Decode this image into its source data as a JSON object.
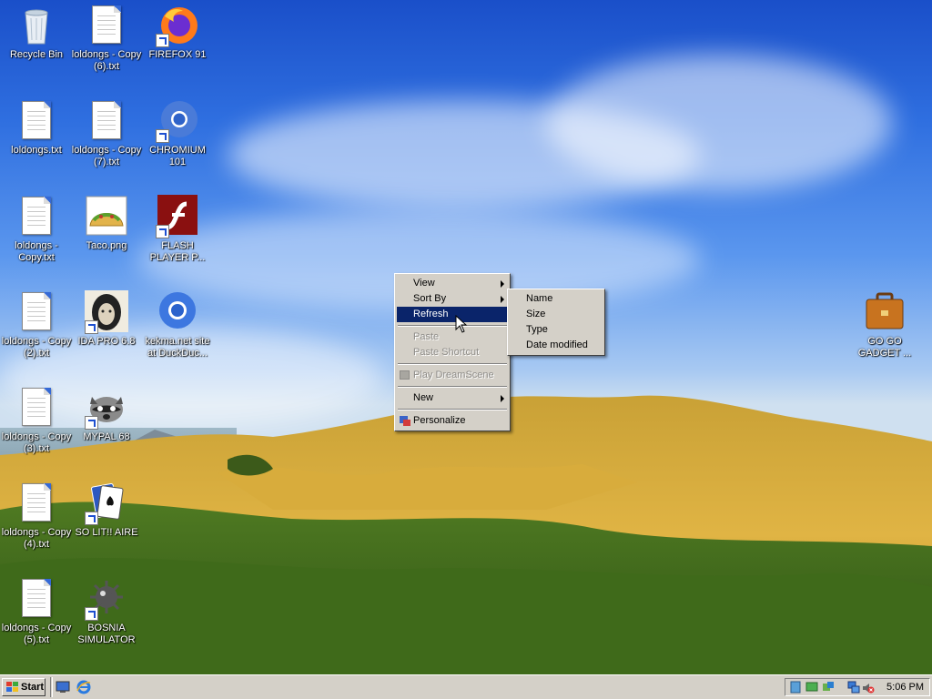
{
  "desktop": {
    "icons": [
      {
        "label": "Recycle Bin",
        "icon": "recycle-bin-icon"
      },
      {
        "label": "loldongs - Copy (6).txt",
        "icon": "text-file-icon"
      },
      {
        "label": "FIREFOX 91",
        "icon": "firefox-icon"
      },
      {
        "label": "loldongs.txt",
        "icon": "text-file-icon"
      },
      {
        "label": "loldongs - Copy (7).txt",
        "icon": "text-file-icon"
      },
      {
        "label": "CHROMIUM 101",
        "icon": "chromium-icon"
      },
      {
        "label": "loldongs - Copy.txt",
        "icon": "text-file-icon"
      },
      {
        "label": "Taco.png",
        "icon": "taco-image-icon"
      },
      {
        "label": "FLASH PLAYER P...",
        "icon": "flash-player-icon"
      },
      {
        "label": "loldongs - Copy (2).txt",
        "icon": "text-file-icon"
      },
      {
        "label": "IDA PRO 6.8",
        "icon": "ida-pro-icon"
      },
      {
        "label": "kekma.net site at DuckDuc...",
        "icon": "chrome-shortcut-icon"
      },
      {
        "label": "GO GO GADGET ...",
        "icon": "briefcase-icon"
      },
      {
        "label": "loldongs - Copy (3).txt",
        "icon": "text-file-icon"
      },
      {
        "label": "MYPAL 68",
        "icon": "mypal-raccoon-icon"
      },
      {
        "label": "loldongs - Copy (4).txt",
        "icon": "text-file-icon"
      },
      {
        "label": "SO LIT!! AIRE",
        "icon": "solitaire-cards-icon"
      },
      {
        "label": "loldongs - Copy (5).txt",
        "icon": "text-file-icon"
      },
      {
        "label": "BOSNIA SIMULATOR",
        "icon": "mine-icon"
      }
    ]
  },
  "context_menu": {
    "items": [
      {
        "label": "View",
        "submenu": true
      },
      {
        "label": "Sort By",
        "submenu": true
      },
      {
        "label": "Refresh",
        "selected": true
      },
      {
        "label": "Paste",
        "disabled": true
      },
      {
        "label": "Paste Shortcut",
        "disabled": true
      },
      {
        "label": "Play DreamScene",
        "disabled": true
      },
      {
        "label": "New",
        "submenu": true
      },
      {
        "label": "Personalize"
      }
    ]
  },
  "sort_submenu": {
    "items": [
      "Name",
      "Size",
      "Type",
      "Date modified"
    ]
  },
  "taskbar": {
    "start_label": "Start",
    "clock": "5:06 PM"
  },
  "colors": {
    "menu_highlight": "#0a246a",
    "menu_face": "#d4d0c8"
  }
}
